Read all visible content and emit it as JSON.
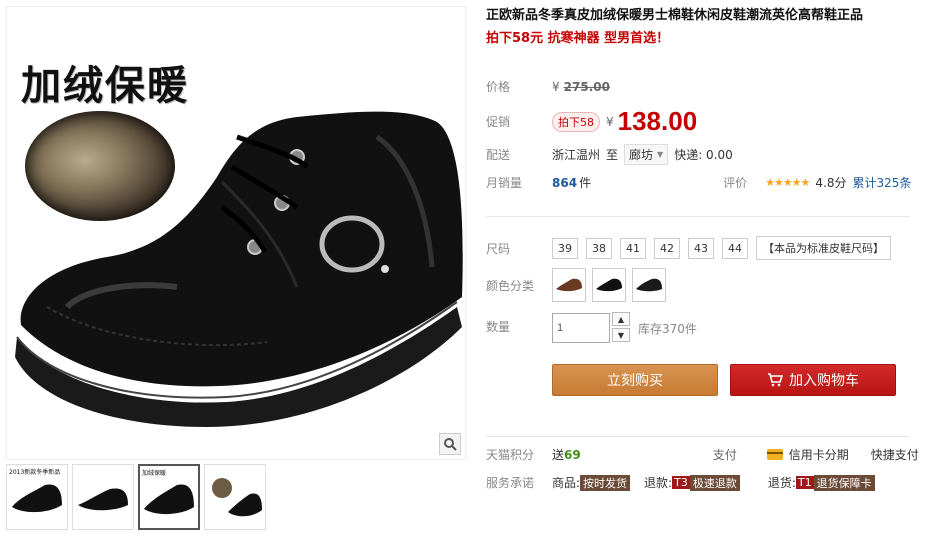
{
  "gallery": {
    "banner_text": "加绒保暖",
    "zoom_icon": "magnifier-icon",
    "thumbnails": [
      {
        "tag": "2013新款冬季新品",
        "active": false
      },
      {
        "tag": "",
        "active": false
      },
      {
        "tag": "加绒保暖",
        "active": true
      },
      {
        "tag": "",
        "active": false
      }
    ]
  },
  "product": {
    "title": "正欧新品冬季真皮加绒保暖男士棉鞋休闲皮鞋潮流英伦高帮鞋正品",
    "subtitle": "拍下58元 抗寒神器 型男首选！"
  },
  "price": {
    "label": "价格",
    "yen": "¥",
    "original": "275.00"
  },
  "promo": {
    "label": "促销",
    "badge": "拍下58",
    "yen": "¥",
    "price": "138.00"
  },
  "shipping": {
    "label": "配送",
    "from": "浙江温州",
    "to_word": "至",
    "destination": "廊坊",
    "express": "快递: 0.00"
  },
  "sales": {
    "label": "月销量",
    "count": "864",
    "unit": "件",
    "rating_label": "评价",
    "stars": "★★★★★",
    "score": "4.8分",
    "reviews": "累计325条"
  },
  "size": {
    "label": "尺码",
    "options": [
      "39",
      "38",
      "41",
      "42",
      "43",
      "44"
    ],
    "note": "【本品为标准皮鞋尺码】"
  },
  "color": {
    "label": "颜色分类",
    "swatches": [
      "brown-shoe",
      "black-shoe",
      "black-shoe-2"
    ]
  },
  "quantity": {
    "label": "数量",
    "value": "1",
    "stock": "库存370件",
    "up": "▲",
    "down": "▼"
  },
  "actions": {
    "buy_now": "立刻购买",
    "add_cart": "加入购物车"
  },
  "points": {
    "label": "天猫积分",
    "prefix": "送",
    "value": "69",
    "pay_label": "支付",
    "credit": "信用卡分期",
    "quick": "快捷支付"
  },
  "services": {
    "label": "服务承诺",
    "goods_label": "商品:",
    "goods_tag": "按时发货",
    "refund_label": "退款:",
    "refund_code": "T3",
    "refund_tag": "极速退款",
    "return_label": "退货:",
    "return_code": "T1",
    "return_tag": "退货保障卡"
  }
}
